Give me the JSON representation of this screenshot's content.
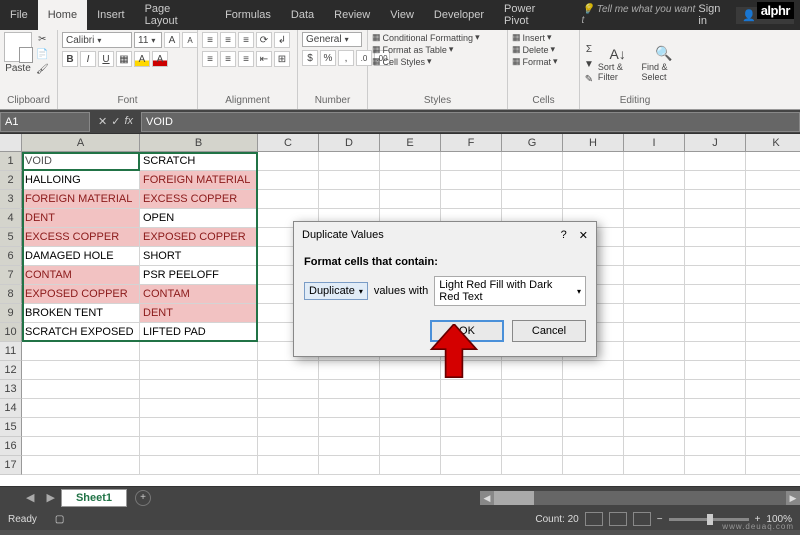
{
  "logo": "alphr",
  "menu": {
    "file": "File"
  },
  "tabs": [
    "Home",
    "Insert",
    "Page Layout",
    "Formulas",
    "Data",
    "Review",
    "View",
    "Developer",
    "Power Pivot"
  ],
  "tellme": "Tell me what you want t",
  "signin": "Sign in",
  "share": "Share",
  "ribbon": {
    "paste": "Paste",
    "clipboard": "Clipboard",
    "font": {
      "name": "Calibri",
      "size": "11",
      "label": "Font"
    },
    "alignment": "Alignment",
    "number": {
      "format": "General",
      "label": "Number"
    },
    "styles": {
      "cf": "Conditional Formatting",
      "fat": "Format as Table",
      "cs": "Cell Styles",
      "label": "Styles"
    },
    "cells": {
      "insert": "Insert",
      "delete": "Delete",
      "format": "Format",
      "label": "Cells"
    },
    "editing": {
      "sort": "Sort & Filter",
      "find": "Find & Select",
      "label": "Editing"
    }
  },
  "namebox": "A1",
  "formula": "VOID",
  "columns": [
    "A",
    "B",
    "C",
    "D",
    "E",
    "F",
    "G",
    "H",
    "I",
    "J",
    "K"
  ],
  "data": [
    {
      "a": {
        "v": "VOID",
        "dup": false
      },
      "b": {
        "v": "SCRATCH",
        "dup": false
      }
    },
    {
      "a": {
        "v": "HALLOING",
        "dup": false
      },
      "b": {
        "v": "FOREIGN MATERIAL",
        "dup": true
      }
    },
    {
      "a": {
        "v": "FOREIGN MATERIAL",
        "dup": true
      },
      "b": {
        "v": "EXCESS COPPER",
        "dup": true
      }
    },
    {
      "a": {
        "v": "DENT",
        "dup": true
      },
      "b": {
        "v": "OPEN",
        "dup": false
      }
    },
    {
      "a": {
        "v": "EXCESS COPPER",
        "dup": true
      },
      "b": {
        "v": "EXPOSED COPPER",
        "dup": true
      }
    },
    {
      "a": {
        "v": "DAMAGED HOLE",
        "dup": false
      },
      "b": {
        "v": "SHORT",
        "dup": false
      }
    },
    {
      "a": {
        "v": "CONTAM",
        "dup": true
      },
      "b": {
        "v": "PSR PEELOFF",
        "dup": false
      }
    },
    {
      "a": {
        "v": "EXPOSED COPPER",
        "dup": true
      },
      "b": {
        "v": "CONTAM",
        "dup": true
      }
    },
    {
      "a": {
        "v": "BROKEN TENT",
        "dup": false
      },
      "b": {
        "v": "DENT",
        "dup": true
      }
    },
    {
      "a": {
        "v": "SCRATCH EXPOSED",
        "dup": false
      },
      "b": {
        "v": "LIFTED PAD",
        "dup": false
      }
    }
  ],
  "dialog": {
    "title": "Duplicate Values",
    "heading": "Format cells that contain:",
    "mode": "Duplicate",
    "mid": "values with",
    "style": "Light Red Fill with Dark Red Text",
    "ok": "OK",
    "cancel": "Cancel"
  },
  "sheet": "Sheet1",
  "status": {
    "ready": "Ready",
    "count": "Count: 20",
    "zoom": "100%"
  },
  "watermark": "www.deuaq.com"
}
